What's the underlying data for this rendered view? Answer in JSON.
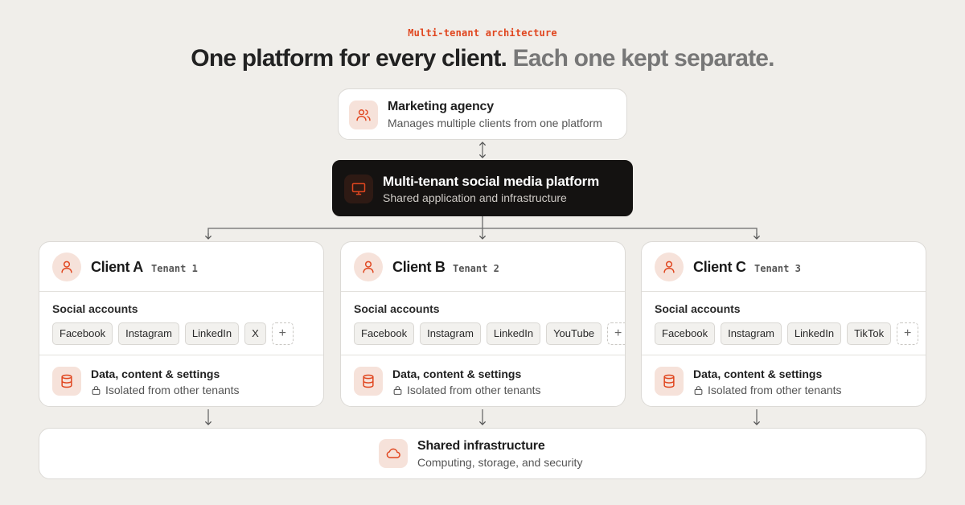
{
  "eyebrow": "Multi-tenant architecture",
  "headline": {
    "main": "One platform for every client.",
    "muted": "Each one kept separate."
  },
  "agency": {
    "title": "Marketing agency",
    "subtitle": "Manages multiple clients from one platform",
    "icon": "users-icon"
  },
  "platform": {
    "title": "Multi-tenant social media platform",
    "subtitle": "Shared application and infrastructure",
    "icon": "monitor-icon"
  },
  "clients": [
    {
      "name": "Client A",
      "tenant": "Tenant 1",
      "social_label": "Social accounts",
      "accounts": [
        "Facebook",
        "Instagram",
        "LinkedIn",
        "X"
      ],
      "data_title": "Data, content & settings",
      "data_sub": "Isolated from other tenants"
    },
    {
      "name": "Client B",
      "tenant": "Tenant 2",
      "social_label": "Social accounts",
      "accounts": [
        "Facebook",
        "Instagram",
        "LinkedIn",
        "YouTube"
      ],
      "data_title": "Data, content & settings",
      "data_sub": "Isolated from other tenants"
    },
    {
      "name": "Client C",
      "tenant": "Tenant 3",
      "social_label": "Social accounts",
      "accounts": [
        "Facebook",
        "Instagram",
        "LinkedIn",
        "TikTok"
      ],
      "data_title": "Data, content & settings",
      "data_sub": "Isolated from other tenants"
    }
  ],
  "infra": {
    "title": "Shared infrastructure",
    "subtitle": "Computing, storage, and security",
    "icon": "cloud-icon"
  },
  "colors": {
    "accent": "#e0461f",
    "background": "#f0eeea",
    "dark_card": "#141211"
  }
}
